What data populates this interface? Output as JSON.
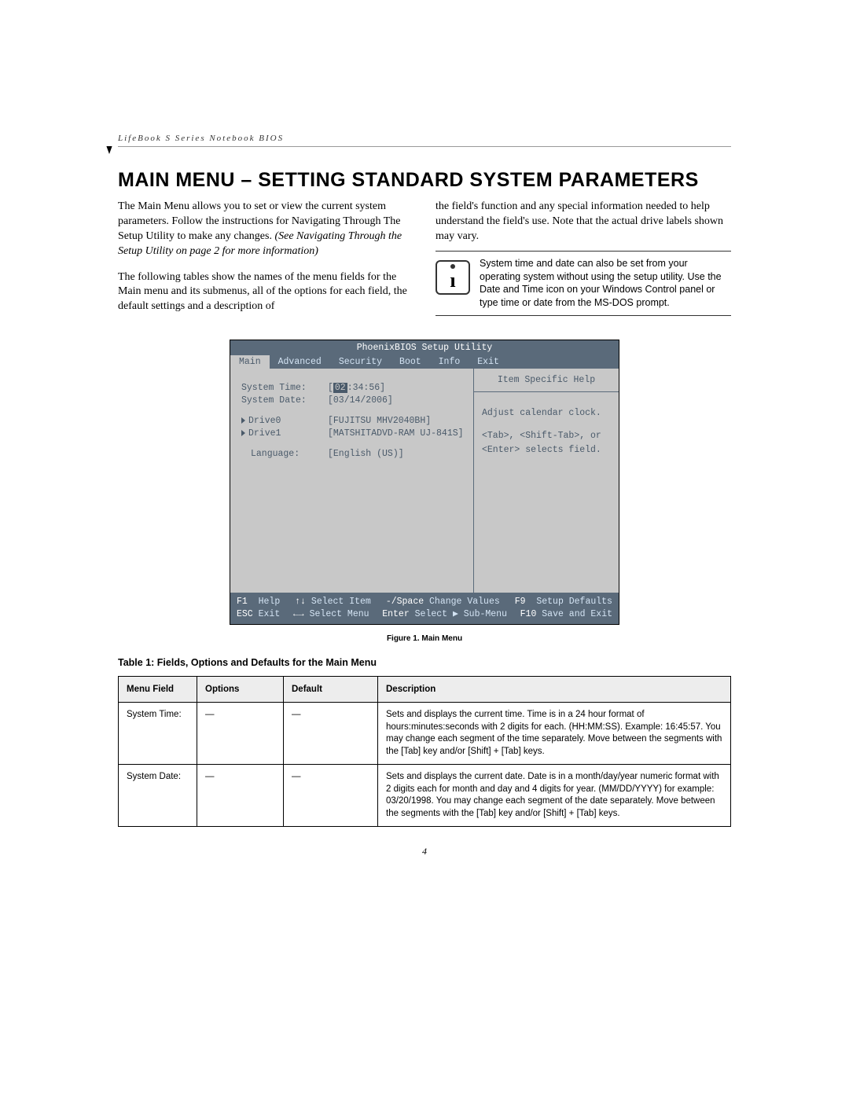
{
  "breadcrumb": "LifeBook S Series Notebook BIOS",
  "heading": "MAIN MENU – SETTING STANDARD SYSTEM PARAMETERS",
  "intro": {
    "left1": "The Main Menu allows you to set or view the current system parameters. Follow the instructions for Navigating Through The Setup Utility to make any changes. ",
    "left1_italic": "(See Navigating Through the Setup Utility on page 2 for more information)",
    "left2": "The following tables show the names of the menu fields for the Main menu and its submenus, all of the options for each field, the default settings and a description of",
    "right1": "the field's function and any special information needed to help understand the field's use. Note that the actual drive labels shown may vary.",
    "info_text": "System time and date can also be set from your operating system without using the setup utility. Use the Date and Time icon on your Windows Control panel or type time or date from the MS-DOS prompt."
  },
  "bios": {
    "title": "PhoenixBIOS Setup Utility",
    "tabs": [
      "Main",
      "Advanced",
      "Security",
      "Boot",
      "Info",
      "Exit"
    ],
    "active_tab": "Main",
    "rows": {
      "system_time_label": "System Time:",
      "system_time_value_hl": "02",
      "system_time_value_rest": ":34:56]",
      "system_date_label": "System Date:",
      "system_date_value": "[03/14/2006]",
      "drive0_label": "Drive0",
      "drive0_value": "[FUJITSU MHV2040BH]",
      "drive1_label": "Drive1",
      "drive1_value": "[MATSHITADVD-RAM UJ-841S]",
      "language_label": "Language:",
      "language_value": "[English (US)]"
    },
    "help": {
      "title": "Item Specific Help",
      "line1": "Adjust calendar clock.",
      "line2": "<Tab>, <Shift-Tab>, or",
      "line3": "<Enter> selects field."
    },
    "footer": {
      "f1": "F1",
      "help": "Help",
      "updown": "↑↓",
      "select_item": "Select Item",
      "minspace": "-/Space",
      "change_values": "Change Values",
      "f9": "F9",
      "setup_defaults": "Setup Defaults",
      "esc": "ESC",
      "exit": "Exit",
      "leftright": "←→",
      "select_menu": "Select Menu",
      "enter": "Enter",
      "select_sub": "Select ▶ Sub-Menu",
      "f10": "F10",
      "save_exit": "Save and Exit"
    }
  },
  "figure_caption": "Figure 1.   Main Menu",
  "table_title": "Table 1: Fields, Options and Defaults for the Main Menu",
  "table": {
    "headers": [
      "Menu Field",
      "Options",
      "Default",
      "Description"
    ],
    "rows": [
      {
        "field": "System Time:",
        "options": "—",
        "default": "—",
        "desc": "Sets and displays the current time. Time is in a 24 hour format of hours:minutes:seconds with 2 digits for each. (HH:MM:SS). Example: 16:45:57. You may change each segment of the time separately. Move between the segments with the [Tab] key and/or [Shift] + [Tab] keys."
      },
      {
        "field": "System Date:",
        "options": "—",
        "default": "—",
        "desc": "Sets and displays the current date. Date is in a month/day/year numeric format with 2 digits each for month and day and 4 digits for year. (MM/DD/YYYY) for example: 03/20/1998. You may change each segment of the date separately. Move between the segments with the [Tab] key and/or [Shift] + [Tab] keys."
      }
    ]
  },
  "page_number": "4"
}
